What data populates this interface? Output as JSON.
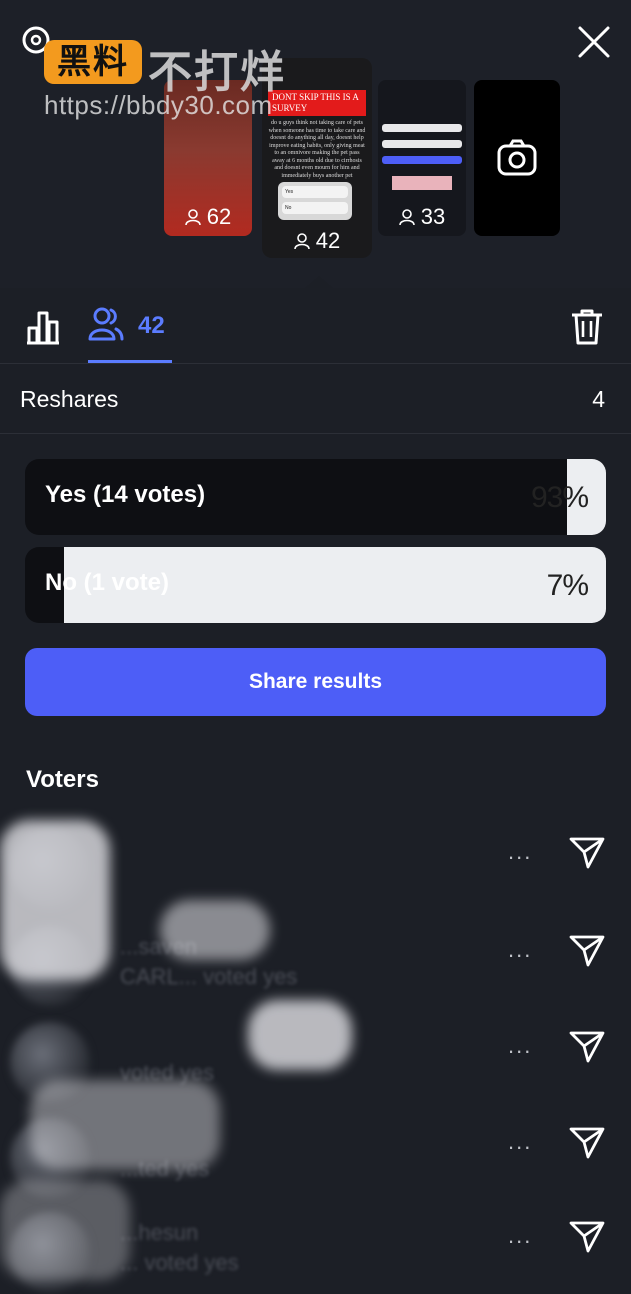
{
  "watermark": {
    "logo": "黑料",
    "text": "不打烊",
    "url": "https://bbdy30.com"
  },
  "stories": [
    {
      "viewers": "62"
    },
    {
      "viewers": "42",
      "poll_title": "DONT SKIP THIS IS A SURVEY",
      "poll_text": "do u guys think not taking care of pets when someone has time to take care and doesnt do anything all day, doesnt help improve eating habits, only giving meat to an omnivore making the pet pass away at 6 months old due to cirrhosis and doesnt even mourn for him and immediately buys another pet",
      "mini_yes": "Yes",
      "mini_no": "No"
    },
    {
      "viewers": "33"
    }
  ],
  "tabs": {
    "viewers_count": "42"
  },
  "reshares": {
    "label": "Reshares",
    "value": "4"
  },
  "poll": {
    "options": [
      {
        "label": "Yes (14 votes)",
        "percent_text": "93%",
        "percent": 93
      },
      {
        "label": "No (1 vote)",
        "percent_text": "7%",
        "percent": 7
      }
    ],
    "share_label": "Share results"
  },
  "voters": {
    "title": "Voters",
    "items": [
      {
        "name": "",
        "sub": ""
      },
      {
        "name": "...saven",
        "sub": "CARL... voted yes"
      },
      {
        "name": "",
        "sub": "voted yes"
      },
      {
        "name": "",
        "sub": "...ted yes"
      },
      {
        "name": "...hesun",
        "sub": "... voted yes"
      }
    ],
    "more_label": "..."
  },
  "colors": {
    "accent": "#5b7cff",
    "button": "#4d5ef7",
    "background": "#1c1f26"
  }
}
